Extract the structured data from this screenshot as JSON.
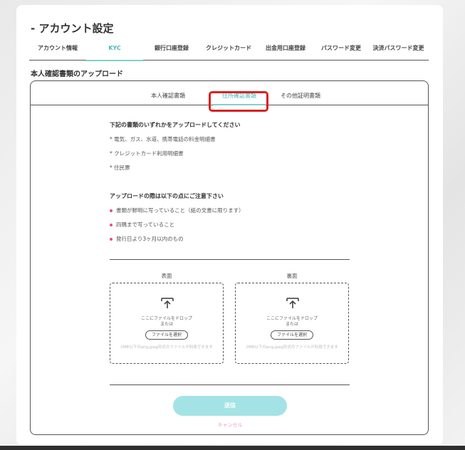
{
  "page": {
    "title": "- アカウント設定"
  },
  "main_tabs": [
    {
      "label": "アカウント情報",
      "active": false
    },
    {
      "label": "KYC",
      "active": true
    },
    {
      "label": "銀行口座登録",
      "active": false
    },
    {
      "label": "クレジットカード",
      "active": false
    },
    {
      "label": "出金用口座登録",
      "active": false
    },
    {
      "label": "パスワード変更",
      "active": false
    },
    {
      "label": "決済パスワード変更",
      "active": false
    }
  ],
  "section": {
    "title": "本人確認書類のアップロード"
  },
  "sub_tabs": [
    {
      "label": "本人確認書類",
      "active": false
    },
    {
      "label": "住所確認書類",
      "active": true
    },
    {
      "label": "その他証明書類",
      "active": false
    }
  ],
  "documents": {
    "heading": "下記の書類のいずれかをアップロードしてください",
    "items": [
      "* 電気、ガス、水道、携帯電話の料金明細書",
      "* クレジットカード利用明細書",
      "* 住民票"
    ]
  },
  "notes": {
    "heading": "アップロードの際は以下の点にご注意下さい",
    "items": [
      "書類が鮮明に写っていること（紙の文書に限ります）",
      "四隅まで写っていること",
      "発行日より3ヶ月以内のもの"
    ]
  },
  "upload": {
    "front": {
      "label": "表面",
      "drop_text": "ここにファイルをドロップ",
      "or_text": "または",
      "button": "ファイルを選択",
      "note": "2MB以下のpng,jpeg形式のファイルが利用できます"
    },
    "back": {
      "label": "裏面",
      "drop_text": "ここにファイルをドロップ",
      "or_text": "または",
      "button": "ファイルを選択",
      "note": "2MB以下のpng,jpeg形式のファイルが利用できます"
    }
  },
  "actions": {
    "submit": "送信",
    "cancel": "キャンセル"
  },
  "colors": {
    "accent": "#4ab8b8",
    "submit_bg": "#a4e3e5",
    "bullet": "#e14e86",
    "highlight": "#d9211e"
  },
  "icons": {
    "upload": "upload-icon",
    "bullet": "bullet-dot-icon"
  }
}
